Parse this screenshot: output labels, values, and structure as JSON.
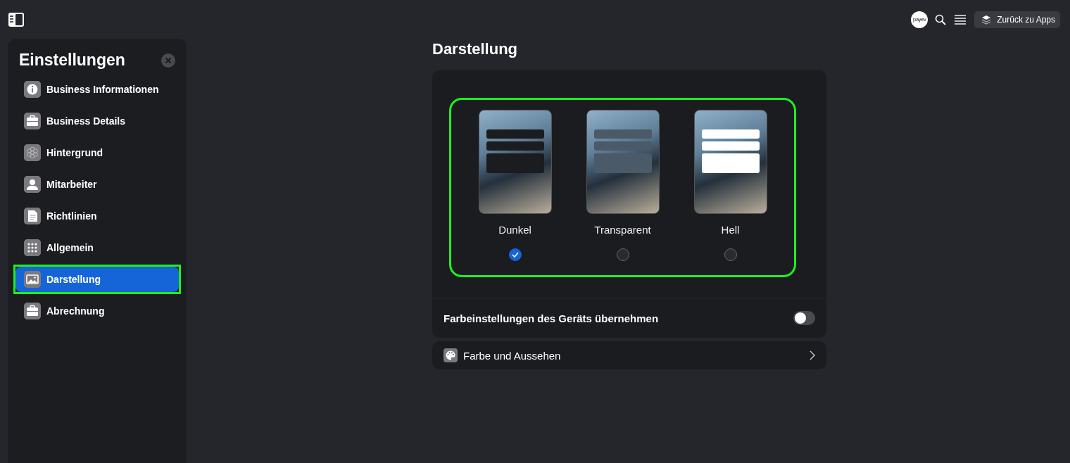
{
  "top_bar": {
    "logo_text": "payev",
    "back_button": "Zurück zu Apps"
  },
  "sidebar": {
    "title": "Einstellungen",
    "items": [
      {
        "label": "Business Informationen",
        "kind": "info",
        "selected": false,
        "highlighted": false
      },
      {
        "label": "Business Details",
        "kind": "briefcase",
        "selected": false,
        "highlighted": false
      },
      {
        "label": "Hintergrund",
        "kind": "flower",
        "selected": false,
        "highlighted": false
      },
      {
        "label": "Mitarbeiter",
        "kind": "person",
        "selected": false,
        "highlighted": false
      },
      {
        "label": "Richtlinien",
        "kind": "document",
        "selected": false,
        "highlighted": false
      },
      {
        "label": "Allgemein",
        "kind": "grid",
        "selected": false,
        "highlighted": false
      },
      {
        "label": "Darstellung",
        "kind": "image",
        "selected": true,
        "highlighted": true
      },
      {
        "label": "Abrechnung",
        "kind": "briefcase",
        "selected": false,
        "highlighted": false
      }
    ]
  },
  "page_title": "Darstellung",
  "themes": {
    "highlighted": true,
    "options": [
      {
        "label": "Dunkel",
        "kind": "dark",
        "selected": true
      },
      {
        "label": "Transparent",
        "kind": "transparent",
        "selected": false
      },
      {
        "label": "Hell",
        "kind": "light",
        "selected": false
      }
    ]
  },
  "device_colors": {
    "label": "Farbeinstellungen des Geräts übernehmen",
    "on": false
  },
  "color_link": {
    "label": "Farbe und Aussehen"
  }
}
